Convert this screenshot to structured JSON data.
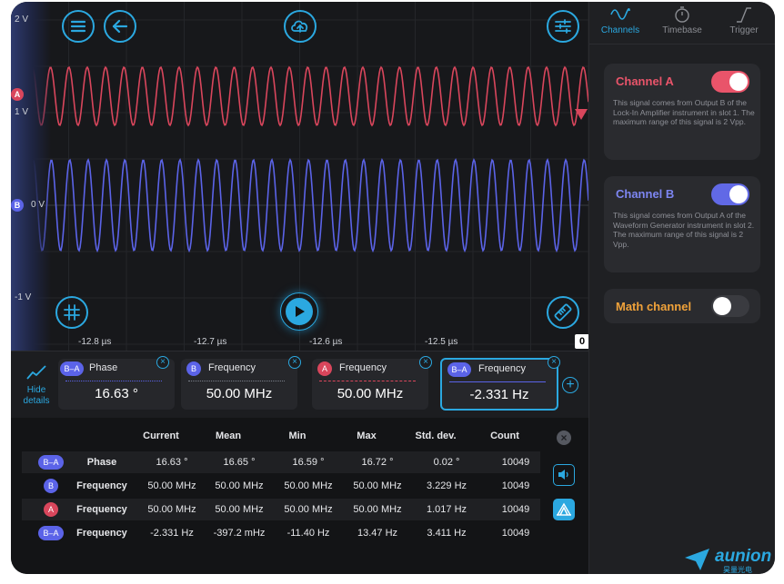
{
  "scope": {
    "voltage_labels": {
      "top": "2 V",
      "a_level": "1 V",
      "zero": "0 V",
      "bottom": "-1 V"
    },
    "channel_markers": {
      "a": "A",
      "b": "B"
    },
    "time_ticks": [
      "-12.8 µs",
      "-12.7 µs",
      "-12.6 µs",
      "-12.5 µs"
    ],
    "offset_marker": "0",
    "colors": {
      "channel_a": "#d9465c",
      "channel_b": "#5b63e8",
      "accent": "#2ba8e0"
    }
  },
  "right_panel": {
    "tabs": [
      {
        "label": "Channels",
        "icon": "sine-wave-icon",
        "active": true
      },
      {
        "label": "Timebase",
        "icon": "stopwatch-icon",
        "active": false
      },
      {
        "label": "Trigger",
        "icon": "trigger-edge-icon",
        "active": false
      }
    ],
    "channel_a": {
      "title": "Channel A",
      "enabled": true,
      "description": "This signal comes from Output B of the Lock-In Amplifier instrument in slot 1. The maximum range of this signal is 2 Vpp."
    },
    "channel_b": {
      "title": "Channel B",
      "enabled": true,
      "description": "This signal comes from Output A of the Waveform Generator instrument in slot 2. The maximum range of this signal is 2 Vpp."
    },
    "math_channel": {
      "title": "Math channel",
      "enabled": false
    }
  },
  "measurements": {
    "hide_details_label": "Hide details",
    "cards": [
      {
        "badge": "B–A",
        "name": "Phase",
        "value": "16.63 °",
        "selected": false
      },
      {
        "badge": "B",
        "name": "Frequency",
        "value": "50.00 MHz",
        "selected": false
      },
      {
        "badge": "A",
        "name": "Frequency",
        "value": "50.00 MHz",
        "selected": false
      },
      {
        "badge": "B–A",
        "name": "Frequency",
        "value": "-2.331 Hz",
        "selected": true
      }
    ]
  },
  "stats_table": {
    "headers": [
      "Current",
      "Mean",
      "Min",
      "Max",
      "Std. dev.",
      "Count"
    ],
    "rows": [
      {
        "badge": "B–A",
        "name": "Phase",
        "values": [
          "16.63 °",
          "16.65 °",
          "16.59 °",
          "16.72 °",
          "0.02 °",
          "10049"
        ]
      },
      {
        "badge": "B",
        "name": "Frequency",
        "values": [
          "50.00 MHz",
          "50.00 MHz",
          "50.00 MHz",
          "50.00 MHz",
          "3.229 Hz",
          "10049"
        ]
      },
      {
        "badge": "A",
        "name": "Frequency",
        "values": [
          "50.00 MHz",
          "50.00 MHz",
          "50.00 MHz",
          "50.00 MHz",
          "1.017 Hz",
          "10049"
        ]
      },
      {
        "badge": "B–A",
        "name": "Frequency",
        "values": [
          "-2.331 Hz",
          "-397.2 mHz",
          "-11.40 Hz",
          "13.47 Hz",
          "3.411 Hz",
          "10049"
        ]
      }
    ]
  },
  "watermark": {
    "brand": "aunion",
    "sub": "昊量光电"
  }
}
